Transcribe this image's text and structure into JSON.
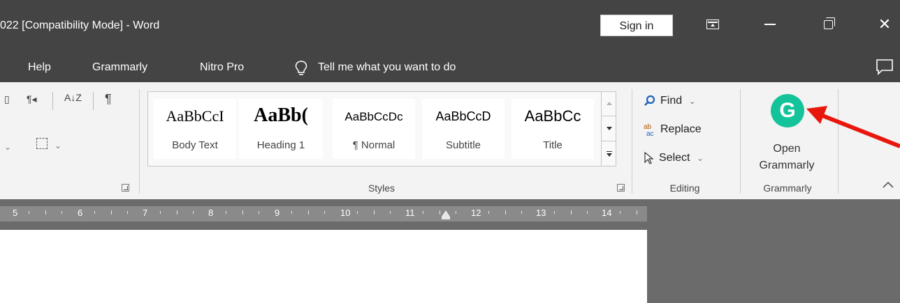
{
  "window": {
    "title": "022 [Compatibility Mode]  -  Word",
    "sign_in_label": "Sign in"
  },
  "tabs": {
    "help": "Help",
    "grammarly": "Grammarly",
    "nitro_pro": "Nitro Pro",
    "tell_me": "Tell me what you want to do"
  },
  "ribbon": {
    "paragraph": {
      "pilcrow": "¶",
      "sort": "A↓Z"
    },
    "styles": {
      "group_label": "Styles",
      "items": [
        {
          "preview": "AaBbCcI",
          "name": "Body Text"
        },
        {
          "preview": "AaBb(",
          "name": "Heading 1"
        },
        {
          "preview": "AaBbCcDc",
          "name": "¶ Normal"
        },
        {
          "preview": "AaBbCcD",
          "name": "Subtitle"
        },
        {
          "preview": "AaBbCc",
          "name": "Title"
        }
      ]
    },
    "editing": {
      "group_label": "Editing",
      "find": "Find",
      "replace": "Replace",
      "select": "Select"
    },
    "grammarly": {
      "group_label": "Grammarly",
      "open_label_line1": "Open",
      "open_label_line2": "Grammarly",
      "logo_letter": "G",
      "brand_color": "#15c39a"
    }
  },
  "ruler": {
    "numbers": [
      "5",
      "6",
      "7",
      "8",
      "9",
      "10",
      "11",
      "12",
      "13",
      "14"
    ]
  },
  "annotation": {
    "arrow_color": "#e8170c"
  }
}
